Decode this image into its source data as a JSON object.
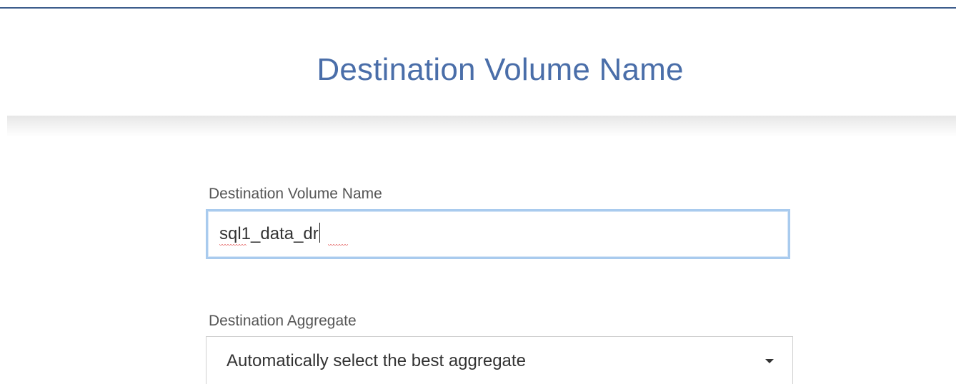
{
  "header": {
    "title": "Destination Volume Name"
  },
  "form": {
    "volume_name": {
      "label": "Destination Volume Name",
      "value": "sql1_data_dr"
    },
    "aggregate": {
      "label": "Destination Aggregate",
      "selected": "Automatically select the best aggregate"
    }
  },
  "icons": {
    "dropdown": "caret-down-icon"
  },
  "colors": {
    "title": "#4a6ea9",
    "top_rule": "#3d5d8c",
    "focus_border": "#a9cbee",
    "label": "#555555",
    "spellcheck": "#e05050"
  }
}
